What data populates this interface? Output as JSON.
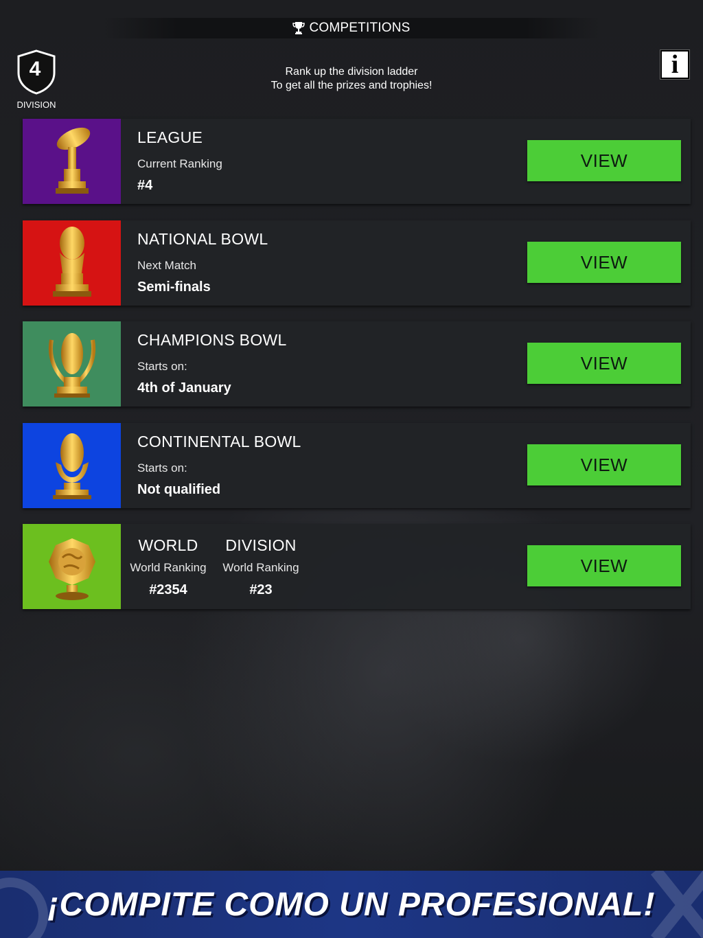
{
  "header": {
    "title": "COMPETITIONS",
    "subtitle_line1": "Rank up the division ladder",
    "subtitle_line2": "To get all the prizes and trophies!",
    "info_label": "i"
  },
  "division": {
    "number": "4",
    "label": "DIVISION"
  },
  "competitions": [
    {
      "name": "LEAGUE",
      "sub_label": "Current Ranking",
      "value": "#4",
      "button": "VIEW",
      "color": "#5a1189",
      "icon": "league-trophy-icon"
    },
    {
      "name": "NATIONAL BOWL",
      "sub_label": "Next Match",
      "value": "Semi-finals",
      "button": "VIEW",
      "color": "#d61313",
      "icon": "national-bowl-trophy-icon"
    },
    {
      "name": "CHAMPIONS BOWL",
      "sub_label": "Starts on:",
      "value": "4th of January",
      "button": "VIEW",
      "color": "#3f8d5e",
      "icon": "champions-bowl-trophy-icon"
    },
    {
      "name": "CONTINENTAL BOWL",
      "sub_label": "Starts on:",
      "value": "Not qualified",
      "button": "VIEW",
      "color": "#0d44e0",
      "icon": "continental-bowl-trophy-icon"
    }
  ],
  "world": {
    "color": "#6cbf1f",
    "icon": "world-trophy-icon",
    "world_name": "WORLD",
    "world_sub": "World Ranking",
    "world_value": "#2354",
    "division_name": "DIVISION",
    "division_sub": "World Ranking",
    "division_value": "#23",
    "button": "VIEW"
  },
  "banner": {
    "text": "¡COMPITE COMO UN PROFESIONAL!"
  },
  "colors": {
    "button_green": "#4ccd37",
    "card_bg": "#212327",
    "banner_blue": "#1d3685"
  }
}
